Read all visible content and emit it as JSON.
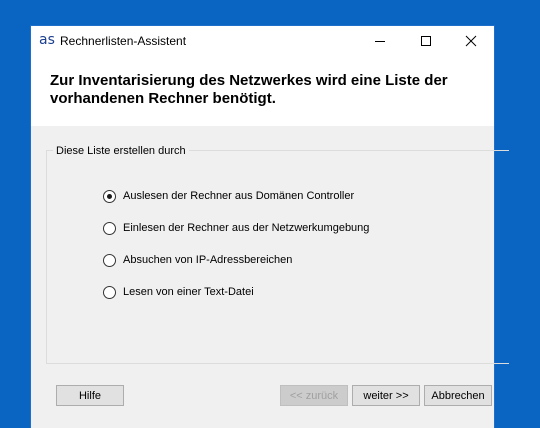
{
  "window": {
    "app_icon_text": "as",
    "title": "Rechnerlisten-Assistent"
  },
  "header": {
    "text": "Zur Inventarisierung des Netzwerkes wird eine Liste der vorhandenen Rechner benötigt."
  },
  "group": {
    "legend": "Diese Liste erstellen durch",
    "options": [
      {
        "label": "Auslesen der Rechner aus Domänen Controller",
        "checked": true
      },
      {
        "label": "Einlesen der Rechner aus der Netzwerkumgebung",
        "checked": false
      },
      {
        "label": "Absuchen von IP-Adressbereichen",
        "checked": false
      },
      {
        "label": "Lesen von einer Text-Datei",
        "checked": false
      }
    ]
  },
  "buttons": {
    "help": "Hilfe",
    "back": "<< zurück",
    "next": "weiter >>",
    "cancel": "Abbrechen"
  },
  "icons": {
    "minimize": "minimize-icon",
    "maximize": "maximize-icon",
    "close": "close-icon"
  },
  "colors": {
    "desktop": "#0a64c2",
    "window": "#f0f0f0",
    "header": "#ffffff"
  }
}
